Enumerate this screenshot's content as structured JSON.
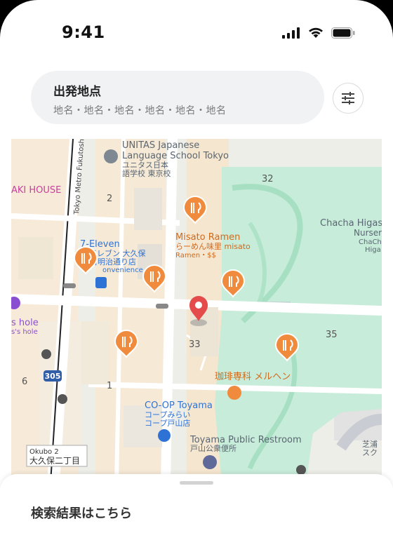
{
  "status_bar": {
    "time": "9:41"
  },
  "search": {
    "title": "出発地点",
    "places": "地名・地名・地名・地名・地名・地名"
  },
  "map": {
    "labels": {
      "unitas_en": "UNITAS Japanese",
      "unitas_en2": "Language School Tokyo",
      "unitas_jp": "ユニタス日本",
      "unitas_jp2": "語学校 東京校",
      "street": "Tokyo Metro Fukutoshin",
      "aki_house": "AKI HOUSE",
      "num_2": "2",
      "num_32": "32",
      "num_33": "33",
      "num_35": "35",
      "num_6": "6",
      "num_1": "1",
      "misato_en": "Misato Ramen",
      "misato_jp": "らーめん味里 misato",
      "misato_sub": "Ramen・$$",
      "seven_en": "7-Eleven",
      "seven_jp": "ン-イレブン 大久保",
      "seven_jp2": "目明治通り店",
      "seven_sub": "onvenience store",
      "chacha1": "Chacha Higas",
      "chacha2": "Nurser",
      "chacha3": "ChaCh",
      "chacha4": "Higa",
      "hole1": "s hole",
      "hole2": "s's hole",
      "route": "305",
      "cafe": "珈琲専科 メルヘン",
      "coop_en": "CO-OP Toyama",
      "coop_jp": "コープみらい",
      "coop_jp2": "コープ戸山店",
      "restroom_en": "Toyama Public Restroom",
      "restroom_jp": "戸山公衆便所",
      "okubo_en": "Okubo 2",
      "okubo_jp": "大久保二丁目",
      "shiba1": "芝浦",
      "shiba2": "スク"
    }
  },
  "results": {
    "title": "検索結果はこちら"
  },
  "colors": {
    "park": "#c7ecd9",
    "road": "#ffffff",
    "food_pin": "#f08a3c",
    "location_pin": "#e44b4b",
    "poi_blue": "#2f72d6"
  }
}
